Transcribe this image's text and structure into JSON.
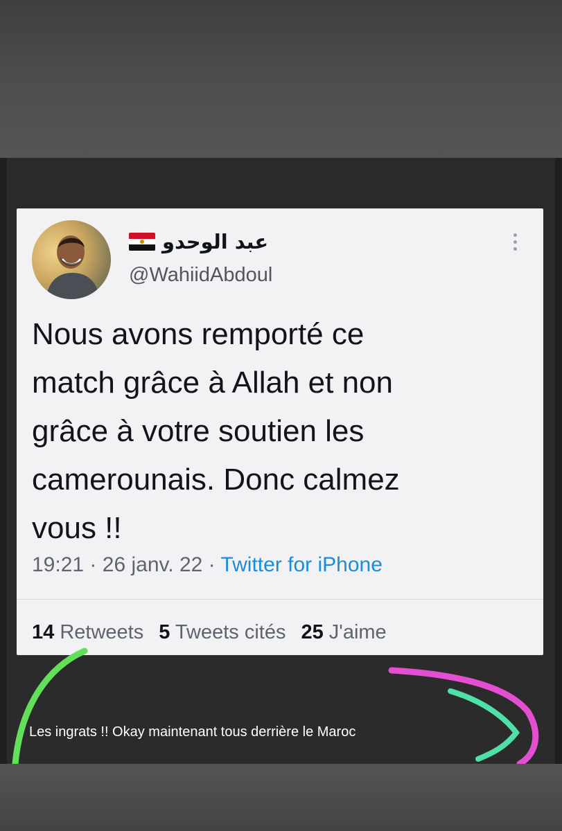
{
  "tweet": {
    "display_name": "عبد الوحدو",
    "flag_icon": "egypt-flag-icon",
    "handle": "@WahiidAbdoul",
    "text_lines": [
      "Nous avons remporté ce",
      "match grâce à Allah et non",
      "grâce à votre soutien les",
      "camerounais. Donc calmez",
      "vous !!"
    ],
    "time": "19:21",
    "date": "26 janv. 22",
    "separator": "·",
    "source": "Twitter for iPhone",
    "stats": {
      "retweets_count": "14",
      "retweets_label": "Retweets",
      "quotes_count": "5",
      "quotes_label": "Tweets cités",
      "likes_count": "25",
      "likes_label": "J'aime"
    }
  },
  "caption": "Les ingrats !! Okay maintenant tous derrière le Maroc",
  "colors": {
    "link_blue": "#1d8cd8",
    "scribble_green": "#62e05a",
    "scribble_pink": "#e24fd0",
    "scribble_teal": "#4fe0a8"
  }
}
